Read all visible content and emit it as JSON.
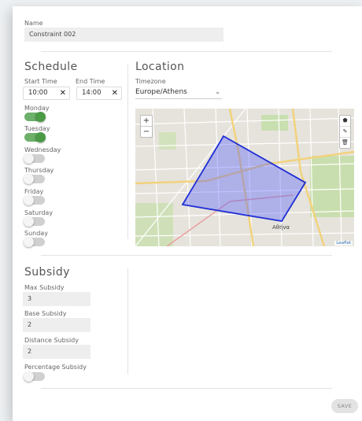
{
  "name": {
    "label": "Name",
    "value": "Constraint 002"
  },
  "schedule": {
    "heading": "Schedule",
    "start_label": "Start Time",
    "end_label": "End Time",
    "start_value": "10:00",
    "end_value": "14:00",
    "clear_glyph": "✕",
    "days": [
      {
        "label": "Monday",
        "on": true
      },
      {
        "label": "Tuesday",
        "on": true
      },
      {
        "label": "Wednesday",
        "on": false
      },
      {
        "label": "Thursday",
        "on": false
      },
      {
        "label": "Friday",
        "on": false
      },
      {
        "label": "Saturday",
        "on": false
      },
      {
        "label": "Sunday",
        "on": false
      }
    ]
  },
  "location": {
    "heading": "Location",
    "timezone_label": "Timezone",
    "timezone_value": "Europe/Athens",
    "map": {
      "zoom_in": "+",
      "zoom_out": "−",
      "attribution": "Leaflet",
      "place_label": "Αθήνα",
      "draw_tools": [
        "polygon-icon",
        "edit-icon",
        "trash-icon"
      ],
      "polygon_color": "#1f2fd6"
    }
  },
  "subsidy": {
    "heading": "Subsidy",
    "fields": [
      {
        "label": "Max Subsidy",
        "value": "3"
      },
      {
        "label": "Base Subsidy",
        "value": "2"
      },
      {
        "label": "Distance Subsidy",
        "value": "2"
      }
    ],
    "percentage_label": "Percentage Subsidy",
    "percentage_on": false
  },
  "save_label": "SAVE",
  "colors": {
    "toggle_on": "#4a9a46",
    "toggle_track_on": "#6db06a"
  }
}
